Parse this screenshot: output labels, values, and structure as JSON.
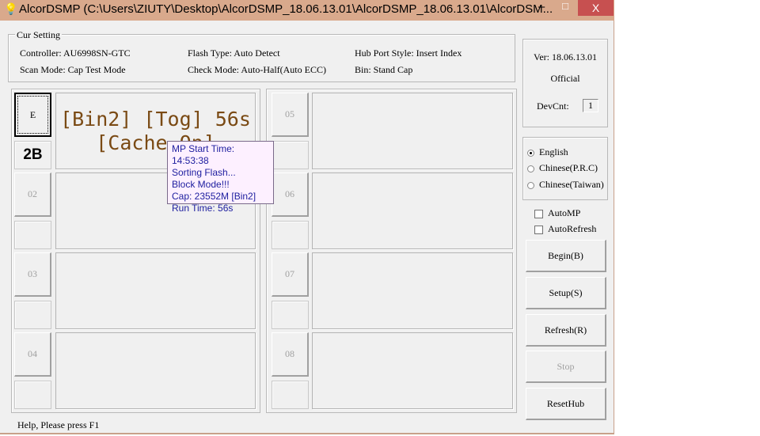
{
  "window": {
    "title": "AlcorDSMP (C:\\Users\\ZIUTY\\Desktop\\AlcorDSMP_18.06.13.01\\AlcorDSMP_18.06.13.01\\AlcorDSM...",
    "minimize": "–",
    "maximize": "□",
    "close": "X",
    "icon": "lightbulb-icon"
  },
  "settings": {
    "legend": "Cur Setting",
    "controller": "Controller: AU6998SN-GTC",
    "flash_type": "Flash Type: Auto Detect",
    "hub_port_style": "Hub Port Style: Insert Index",
    "scan_mode": "Scan Mode: Cap Test Mode",
    "check_mode": "Check Mode: Auto-Half(Auto ECC)",
    "bin": "Bin: Stand Cap"
  },
  "info": {
    "version": "Ver: 18.06.13.01",
    "edition": "Official",
    "devcnt_label": "DevCnt:",
    "devcnt_value": "1"
  },
  "slots": [
    {
      "label": "E",
      "small": "2B",
      "status_line1": "[Bin2] [Tog] 56s",
      "status_line2": "[Cache On]",
      "active": true
    },
    {
      "label": "02",
      "small": ""
    },
    {
      "label": "03",
      "small": ""
    },
    {
      "label": "04",
      "small": ""
    },
    {
      "label": "05",
      "small": ""
    },
    {
      "label": "06",
      "small": ""
    },
    {
      "label": "07",
      "small": ""
    },
    {
      "label": "08",
      "small": ""
    }
  ],
  "tooltip": {
    "lines": [
      "MP Start Time: 14:53:38",
      "Sorting Flash...",
      "Block Mode!!!",
      "Cap: 23552M [Bin2]",
      "Run Time: 56s"
    ]
  },
  "language": {
    "options": [
      "English",
      "Chinese(P.R.C)",
      "Chinese(Taiwan)"
    ],
    "selected": "English"
  },
  "checkboxes": {
    "automp": "AutoMP",
    "autorefresh": "AutoRefresh",
    "automp_checked": false,
    "autorefresh_checked": false
  },
  "buttons": {
    "begin": "Begin(B)",
    "setup": "Setup(S)",
    "refresh": "Refresh(R)",
    "stop": "Stop",
    "resethub": "ResetHub"
  },
  "statusbar": {
    "text": "Help, Please press F1"
  },
  "colors": {
    "titlebar": "#d9a98c",
    "close": "#c75050",
    "status_text": "#7a4a14",
    "tooltip_text": "#2020a0",
    "tooltip_bg": "#fdf0ff"
  }
}
